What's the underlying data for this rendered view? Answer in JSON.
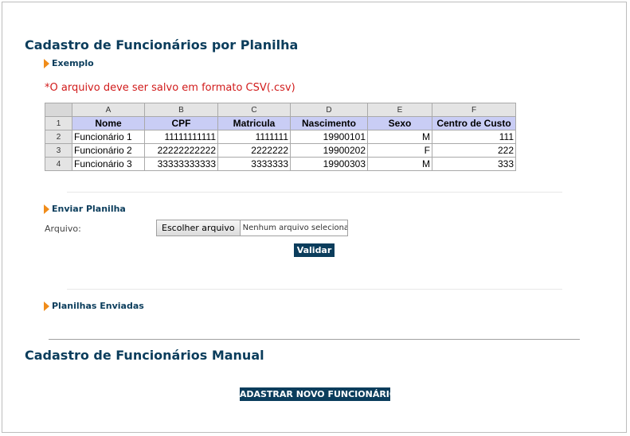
{
  "section1": {
    "title": "Cadastro de Funcionários por Planilha",
    "example_label": "Exemplo",
    "note": "*O arquivo deve ser salvo em formato CSV(.csv)",
    "sheet": {
      "column_letters": [
        "A",
        "B",
        "C",
        "D",
        "E",
        "F"
      ],
      "row_numbers": [
        "1",
        "2",
        "3",
        "4"
      ],
      "headers": [
        "Nome",
        "CPF",
        "Matricula",
        "Nascimento",
        "Sexo",
        "Centro de Custo"
      ],
      "rows": [
        [
          "Funcionário 1",
          "11111111111",
          "1111111",
          "19900101",
          "M",
          "111"
        ],
        [
          "Funcionário 2",
          "22222222222",
          "2222222",
          "19900202",
          "F",
          "222"
        ],
        [
          "Funcionário 3",
          "33333333333",
          "3333333",
          "19900303",
          "M",
          "333"
        ]
      ]
    },
    "upload_label": "Enviar Planilha",
    "file_label": "Arquivo:",
    "file_button": "Escolher arquivo",
    "file_status": "Nenhum arquivo selecionado",
    "validate_button": "Validar",
    "sent_label": "Planilhas Enviadas"
  },
  "section2": {
    "title": "Cadastro de Funcionários Manual",
    "new_button": "CADASTRAR NOVO FUNCIONÁRIO"
  },
  "colors": {
    "brand": "#0b3d5c",
    "accent": "#f08c1a",
    "note": "#d11b1b",
    "header_fill": "#c9cdf5"
  }
}
